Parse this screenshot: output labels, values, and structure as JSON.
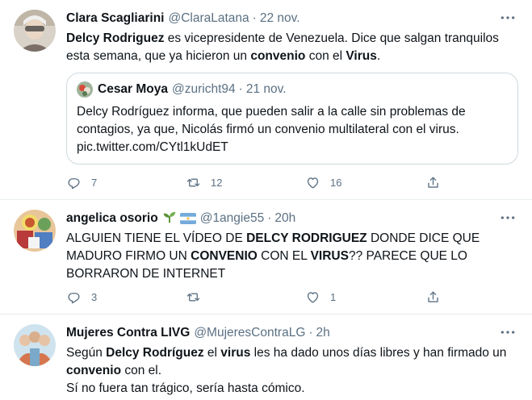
{
  "tweets": [
    {
      "name": "Clara Scagliarini",
      "handle": "@ClaraLatana",
      "time": "22 nov.",
      "segments": [
        {
          "text": "Delcy Rodriguez",
          "bold": true
        },
        {
          "text": " es vicepresidente de Venezuela. Dice que salgan tranquilos esta semana, que ya hicieron un ",
          "bold": false
        },
        {
          "text": "convenio",
          "bold": true
        },
        {
          "text": " con el ",
          "bold": false
        },
        {
          "text": "Virus",
          "bold": true
        },
        {
          "text": ".",
          "bold": false
        }
      ],
      "quote": {
        "name": "Cesar Moya",
        "handle": "@zuricht94",
        "time": "21 nov.",
        "text": "Delcy Rodríguez informa, que pueden salir a la calle sin problemas de contagios, ya que, Nicolás firmó un convenio multilateral con el virus.",
        "link": "pic.twitter.com/CYtl1kUdET"
      },
      "actions": {
        "reply": "7",
        "retweet": "12",
        "like": "16"
      }
    },
    {
      "name": "angelica osorio",
      "handle": "@1angie55",
      "time": "20h",
      "name_decorations": [
        "sprout-emoji",
        "argentina-flag-emoji"
      ],
      "segments": [
        {
          "text": "ALGUIEN TIENE EL VÍDEO DE ",
          "bold": false
        },
        {
          "text": "DELCY RODRIGUEZ",
          "bold": true
        },
        {
          "text": " DONDE DICE QUE MADURO FIRMO UN ",
          "bold": false
        },
        {
          "text": "CONVENIO",
          "bold": true
        },
        {
          "text": " CON EL ",
          "bold": false
        },
        {
          "text": "VIRUS",
          "bold": true
        },
        {
          "text": "?? PARECE QUE LO BORRARON DE INTERNET",
          "bold": false
        }
      ],
      "actions": {
        "reply": "3",
        "retweet": "",
        "like": "1"
      }
    },
    {
      "name": "Mujeres Contra LIVG",
      "handle": "@MujeresContraLG",
      "time": "2h",
      "segments": [
        {
          "text": "Según ",
          "bold": false
        },
        {
          "text": "Delcy Rodríguez",
          "bold": true
        },
        {
          "text": " el ",
          "bold": false
        },
        {
          "text": "virus",
          "bold": true
        },
        {
          "text": " les ha dado unos días libres y han firmado un ",
          "bold": false
        },
        {
          "text": "convenio",
          "bold": true
        },
        {
          "text": " con el.",
          "bold": false
        },
        {
          "text": "\n",
          "bold": false
        },
        {
          "text": "Sí no fuera tan trágico, sería hasta cómico.",
          "bold": false
        }
      ]
    }
  ],
  "separator": "·",
  "icons": {
    "reply": "reply-icon",
    "retweet": "retweet-icon",
    "like": "heart-icon",
    "share": "share-icon",
    "more": "more-icon"
  },
  "colors": {
    "secondary_text": "#5b7083",
    "border": "#e6ecf0",
    "text": "#0f1419"
  }
}
